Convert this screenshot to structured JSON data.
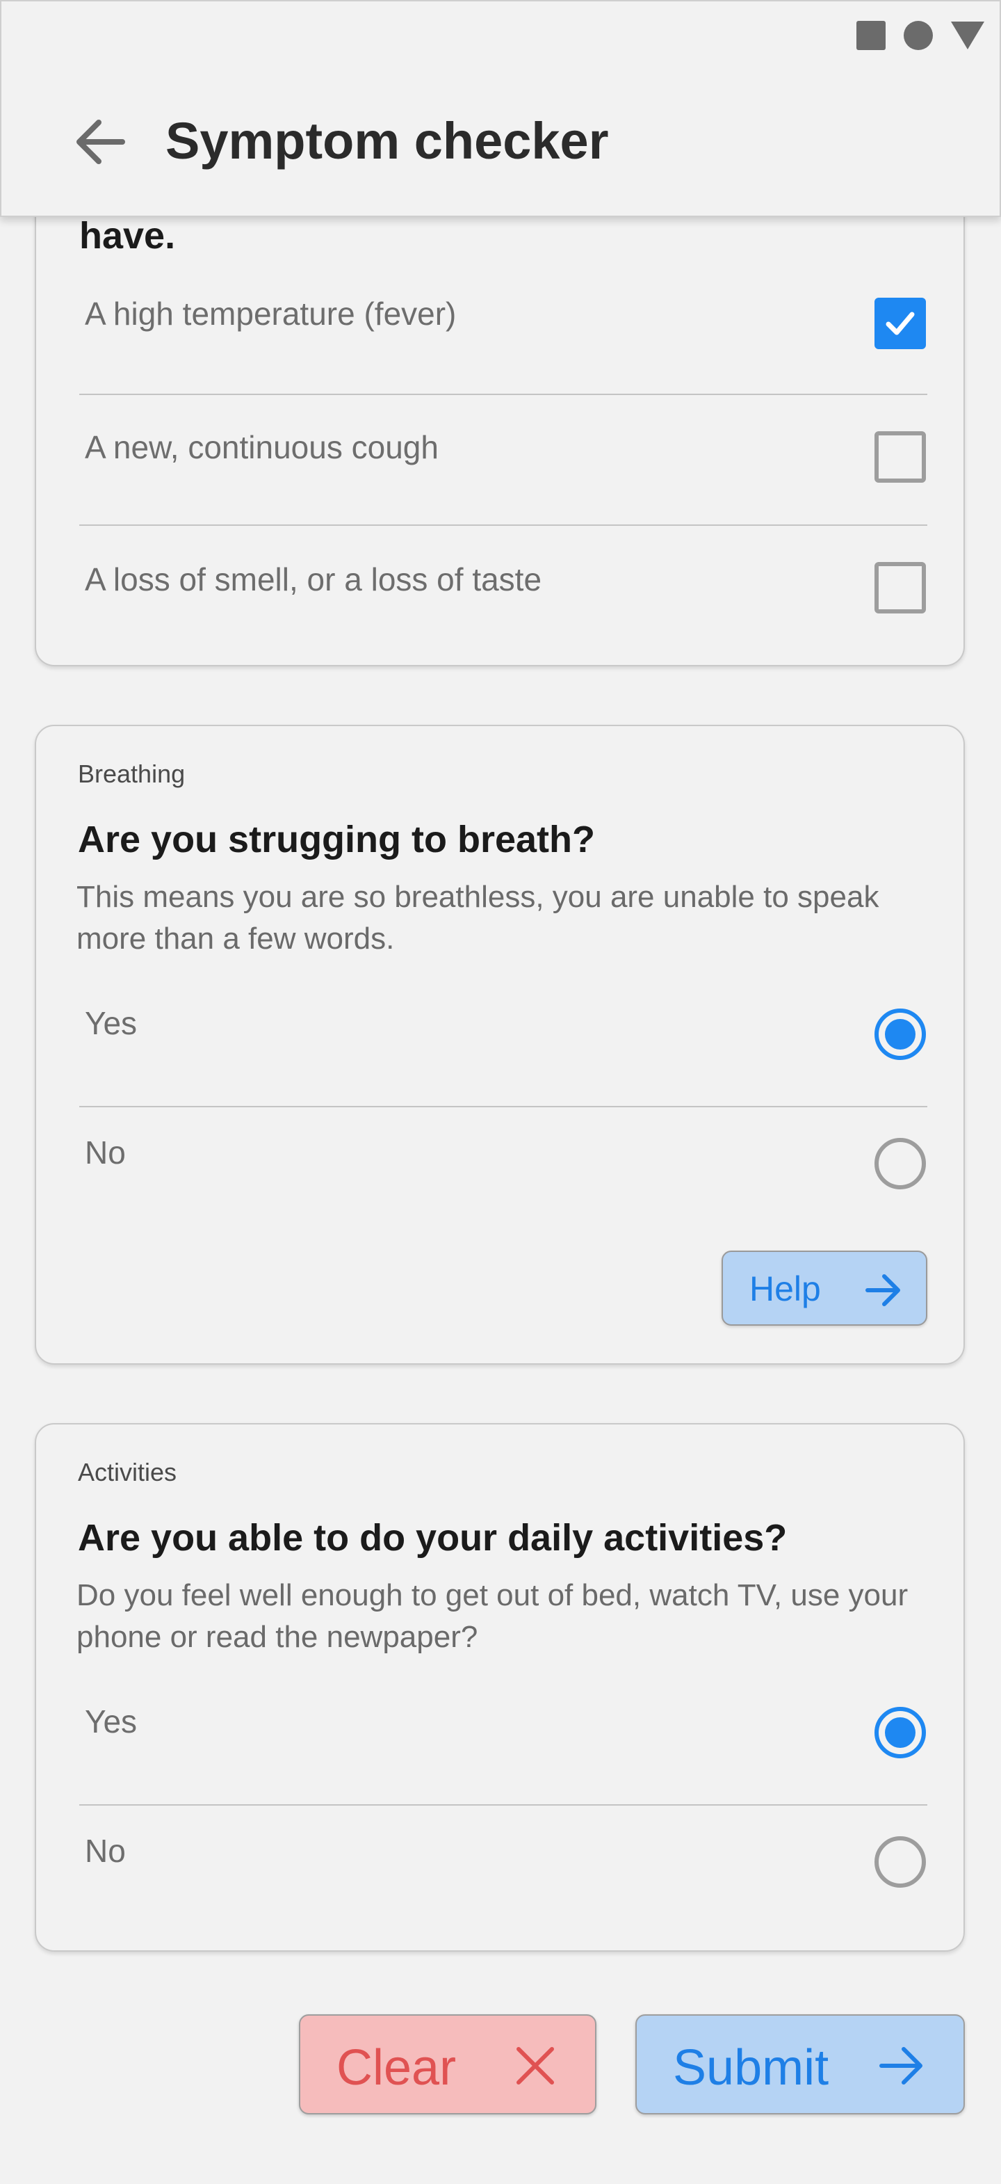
{
  "app_bar": {
    "title": "Symptom checker",
    "back_icon": "arrow-left-icon"
  },
  "status_bar": {
    "icons": [
      "square-icon",
      "circle-icon",
      "triangle-icon"
    ]
  },
  "colors": {
    "accent": "#1e88f2",
    "clear": "#e05252",
    "background": "#f2f2f2"
  },
  "symptoms_card": {
    "question_fragment": "have.",
    "options": [
      {
        "label": "A high temperature (fever)",
        "checked": true
      },
      {
        "label": "A new, continuous cough",
        "checked": false
      },
      {
        "label": "A loss of smell, or a loss of taste",
        "checked": false
      }
    ]
  },
  "breathing_card": {
    "label": "Breathing",
    "question": "Are you strugging to breath?",
    "description": "This means you are so breathless, you are unable to speak more than a few words.",
    "options": [
      {
        "label": "Yes",
        "selected": true
      },
      {
        "label": "No",
        "selected": false
      }
    ],
    "help_label": "Help"
  },
  "activities_card": {
    "label": "Activities",
    "question": "Are you able to do your daily activities?",
    "description": "Do you feel well enough to get out of bed, watch TV, use your phone or read the newpaper?",
    "options": [
      {
        "label": "Yes",
        "selected": true
      },
      {
        "label": "No",
        "selected": false
      }
    ]
  },
  "actions": {
    "clear_label": "Clear",
    "submit_label": "Submit"
  }
}
